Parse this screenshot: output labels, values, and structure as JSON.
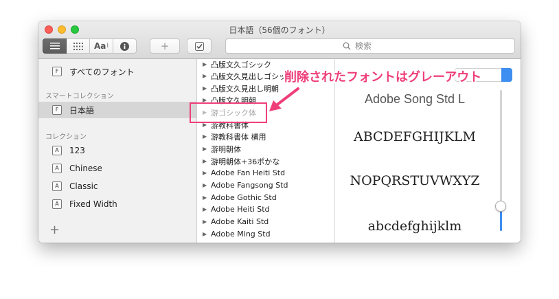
{
  "window": {
    "title": "日本語（56個のフォント）"
  },
  "toolbar": {
    "view_buttons": [
      {
        "icon": "list-icon"
      },
      {
        "icon": "grid-icon"
      },
      {
        "icon": "font-size-icon",
        "label": "Aa"
      },
      {
        "icon": "info-icon"
      }
    ],
    "add_button": "+",
    "validate_icon": "checkbox-icon",
    "search_placeholder": "検索"
  },
  "sidebar": {
    "all_fonts": "すべてのフォント",
    "smart_header": "スマートコレクション",
    "smart_items": [
      "日本語"
    ],
    "collections_header": "コレクション",
    "collections": [
      "123",
      "Chinese",
      "Classic",
      "Fixed Width"
    ],
    "add_label": "+"
  },
  "font_list": {
    "items": [
      {
        "name": "凸版文久ゴシック",
        "grayed": false
      },
      {
        "name": "凸版文久見出しゴシック",
        "grayed": false
      },
      {
        "name": "凸版文久見出し明朝",
        "grayed": false
      },
      {
        "name": "凸版文久明朝",
        "grayed": false
      },
      {
        "name": "游ゴシック体",
        "grayed": true
      },
      {
        "name": "游教科書体",
        "grayed": false
      },
      {
        "name": "游教科書体 横用",
        "grayed": false
      },
      {
        "name": "游明朝体",
        "grayed": false
      },
      {
        "name": "游明朝体+36ポかな",
        "grayed": false
      },
      {
        "name": "Adobe Fan Heiti Std",
        "grayed": false
      },
      {
        "name": "Adobe Fangsong Std",
        "grayed": false
      },
      {
        "name": "Adobe Gothic Std",
        "grayed": false
      },
      {
        "name": "Adobe Heiti Std",
        "grayed": false
      },
      {
        "name": "Adobe Kaiti Std",
        "grayed": false
      },
      {
        "name": "Adobe Ming Std",
        "grayed": false
      }
    ]
  },
  "preview": {
    "font_name": "Adobe Song Std L",
    "line1": "ABCDEFGHIJKLM",
    "line2": "NOPQRSTUVWXYZ",
    "line3": "abcdefghijklm",
    "size_level": 0.2
  },
  "annotation": {
    "text": "削除されたフォントはグレーアウト",
    "color": "#ee3f7a"
  },
  "colors": {
    "accent": "#3d8ef0",
    "grayed_text": "#a4a4a4"
  }
}
